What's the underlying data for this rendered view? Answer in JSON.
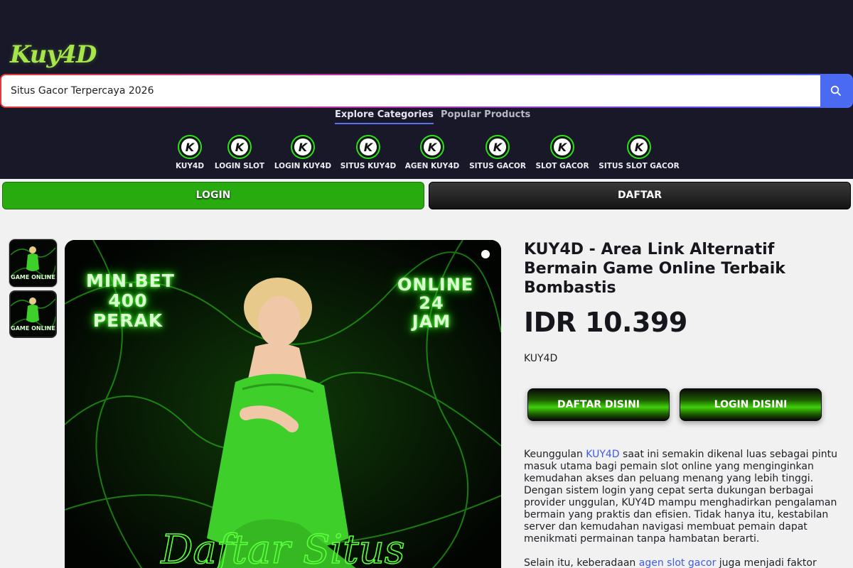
{
  "header": {
    "logo_text": "Kuy4D",
    "search": {
      "value": "Situs Gacor Terpercaya 2026"
    },
    "tabs": [
      {
        "label": "Explore Categories",
        "active": true
      },
      {
        "label": "Popular Products",
        "active": false
      }
    ],
    "categories": [
      {
        "label": "KUY4D"
      },
      {
        "label": "LOGIN SLOT"
      },
      {
        "label": "LOGIN KUY4D"
      },
      {
        "label": "SITUS KUY4D"
      },
      {
        "label": "AGEN KUY4D"
      },
      {
        "label": "SITUS GACOR"
      },
      {
        "label": "SLOT GACOR"
      },
      {
        "label": "SITUS SLOT GACOR"
      }
    ],
    "category_icon_letter": "K"
  },
  "action_bar": {
    "login_label": "LOGIN",
    "daftar_label": "DAFTAR"
  },
  "gallery": {
    "thumb_caption": "GAME ONLINE",
    "hero": {
      "left_text_1": "MIN.BET",
      "left_text_2": "400 PERAK",
      "right_text_1": "ONLINE",
      "right_text_2": "24 JAM",
      "bottom_text": "Daftar Situs"
    }
  },
  "product": {
    "title": "KUY4D - Area Link Alternatif Bermain Game Online Terbaik Bombastis",
    "price": "IDR 10.399",
    "brand": "KUY4D",
    "daftar_button": "DAFTAR DISINI",
    "login_button": "LOGIN DISINI",
    "description": {
      "p1_before": "Keunggulan ",
      "p1_link": "KUY4D",
      "p1_after": " saat ini semakin dikenal luas sebagai pintu masuk utama bagi pemain slot online yang menginginkan kemudahan akses dan peluang menang yang lebih tinggi. Dengan sistem login yang cepat serta dukungan berbagai provider unggulan, KUY4D mampu menghadirkan pengalaman bermain yang praktis dan efisien. Tidak hanya itu, kestabilan server dan kemudahan navigasi membuat pemain dapat menikmati permainan tanpa hambatan berarti.",
      "p2_before": "Selain itu, keberadaan ",
      "p2_link": "agen slot gacor",
      "p2_after": " juga menjadi faktor"
    }
  },
  "colors": {
    "header_bg": "#181828",
    "accent_blue": "#4b6af2",
    "login_green": "#27ab0f",
    "neon_green": "#39ff14"
  }
}
